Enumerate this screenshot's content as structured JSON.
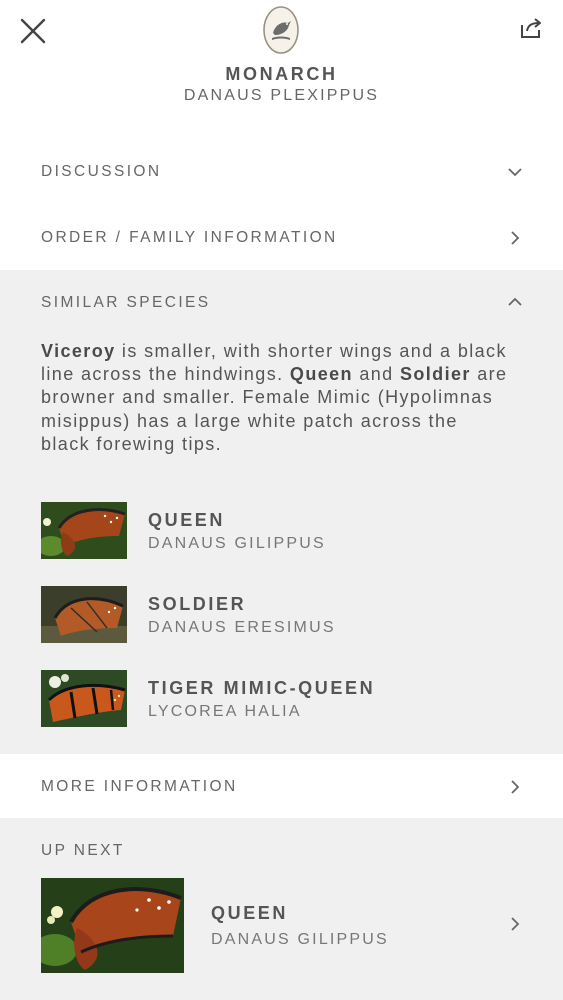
{
  "header": {
    "title": "MONARCH",
    "subtitle": "DANAUS PLEXIPPUS"
  },
  "sections": {
    "discussion": "DISCUSSION",
    "order_family": "ORDER / FAMILY INFORMATION",
    "similar_species": "SIMILAR SPECIES",
    "more_information": "MORE INFORMATION",
    "up_next": "UP NEXT"
  },
  "similar_text": {
    "b1": "Viceroy",
    "t1": " is smaller, with shorter wings and a black line across the hindwings. ",
    "b2": "Queen",
    "t2": " and ",
    "b3": "Soldier",
    "t3": " are browner and smaller. Female Mimic (Hypolimnas misippus) has a large white patch across the black forewing tips."
  },
  "similar_list": [
    {
      "name": "QUEEN",
      "scientific": "DANAUS GILIPPUS"
    },
    {
      "name": "SOLDIER",
      "scientific": "DANAUS ERESIMUS"
    },
    {
      "name": "TIGER MIMIC-QUEEN",
      "scientific": "LYCOREA HALIA"
    }
  ],
  "next": {
    "name": "QUEEN",
    "scientific": "DANAUS GILIPPUS"
  },
  "colors": {
    "background": "#ffffff",
    "section_gray": "#f0f0f0",
    "text": "#555555",
    "wing_orange": "#c2521c",
    "leaf_green": "#3f6b24"
  },
  "icons": {
    "close": "close-icon",
    "share": "share-icon",
    "logo": "bird-logo-icon",
    "expand": "chevron-down-icon",
    "collapse": "chevron-up-icon",
    "navigate": "chevron-right-icon"
  }
}
